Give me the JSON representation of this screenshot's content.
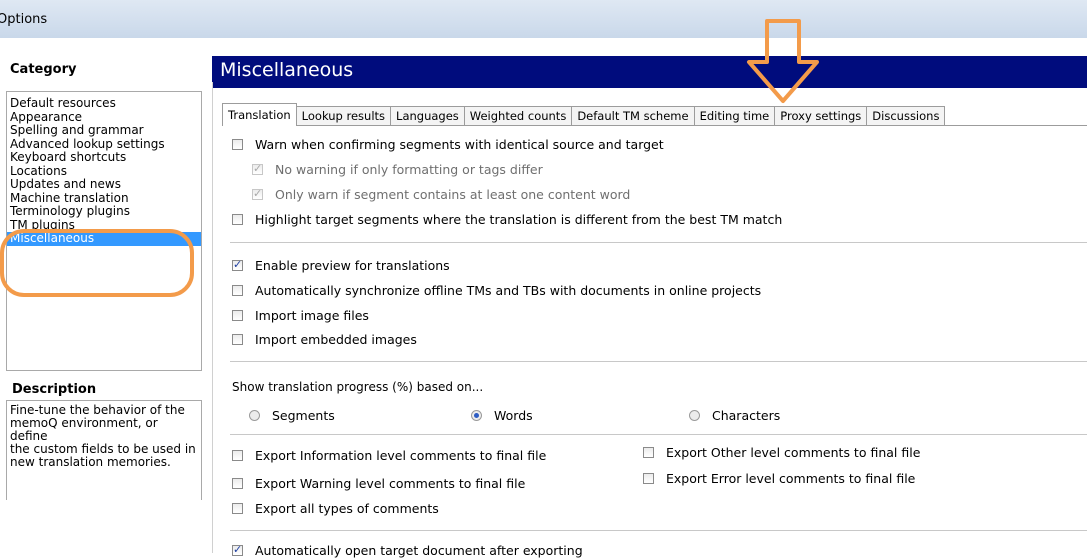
{
  "window": {
    "title": "Options"
  },
  "sidebar": {
    "category_heading": "Category",
    "items": [
      {
        "label": "Default resources"
      },
      {
        "label": "Appearance"
      },
      {
        "label": "Spelling and grammar"
      },
      {
        "label": "Advanced lookup settings"
      },
      {
        "label": "Keyboard shortcuts"
      },
      {
        "label": "Locations"
      },
      {
        "label": "Updates and news"
      },
      {
        "label": "Machine translation"
      },
      {
        "label": "Terminology plugins"
      },
      {
        "label": "TM plugins"
      },
      {
        "label": "Miscellaneous"
      }
    ],
    "selected": "Miscellaneous",
    "description_heading": "Description",
    "description_lines": [
      "Fine-tune the behavior of the",
      "memoQ environment, or define",
      "the custom fields to be used in",
      "new translation memories."
    ]
  },
  "main": {
    "title": "Miscellaneous",
    "tabs": [
      {
        "label": "Translation"
      },
      {
        "label": "Lookup results"
      },
      {
        "label": "Languages"
      },
      {
        "label": "Weighted counts"
      },
      {
        "label": "Default TM scheme"
      },
      {
        "label": "Editing time"
      },
      {
        "label": "Proxy settings"
      },
      {
        "label": "Discussions"
      }
    ],
    "active_tab": "Translation",
    "options": {
      "warn_identical": {
        "label": "Warn when confirming segments with identical source and target",
        "checked": false
      },
      "no_warning_formatting": {
        "label": "No warning if only formatting or tags differ",
        "checked": true,
        "disabled": true
      },
      "only_warn_content": {
        "label": "Only warn if segment contains at least one content word",
        "checked": true,
        "disabled": true
      },
      "highlight_target": {
        "label": "Highlight target segments where the translation is different from the best TM match",
        "checked": false
      },
      "enable_preview": {
        "label": "Enable preview for translations",
        "checked": true
      },
      "auto_sync": {
        "label": "Automatically synchronize offline TMs and TBs with documents in online projects",
        "checked": false
      },
      "import_image_files": {
        "label": "Import image files",
        "checked": false
      },
      "import_embedded_images": {
        "label": "Import embedded images",
        "checked": false
      },
      "progress_label": "Show translation progress (%) based on...",
      "progress_options": [
        {
          "label": "Segments",
          "selected": false
        },
        {
          "label": "Words",
          "selected": true
        },
        {
          "label": "Characters",
          "selected": false
        }
      ],
      "export_information": {
        "label": "Export Information level comments to final file",
        "checked": false
      },
      "export_warning": {
        "label": "Export Warning level comments to final file",
        "checked": false
      },
      "export_all": {
        "label": "Export all types of comments",
        "checked": false
      },
      "export_other": {
        "label": "Export Other level comments to final file",
        "checked": false
      },
      "export_error": {
        "label": "Export Error level comments to final file",
        "checked": false
      },
      "auto_open_target": {
        "label": "Automatically open target document after exporting",
        "checked": true
      }
    }
  },
  "annotation_colors": {
    "highlight": "#f39b4a",
    "heading_bar": "#000c7d",
    "selection": "#3399ff"
  }
}
